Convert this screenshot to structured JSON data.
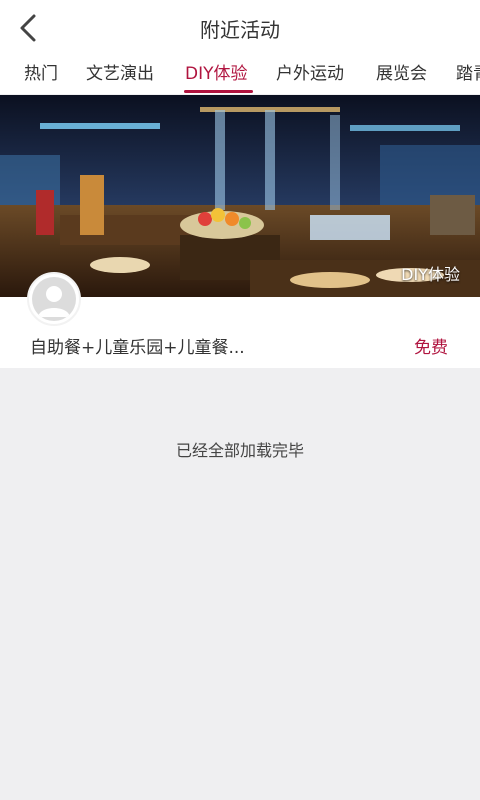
{
  "header": {
    "title": "附近活动",
    "back_icon": "chevron-left-icon"
  },
  "tabs": [
    {
      "label": "热门",
      "active": false
    },
    {
      "label": "文艺演出",
      "active": false
    },
    {
      "label": "DIY体验",
      "active": true
    },
    {
      "label": "户外运动",
      "active": false
    },
    {
      "label": "展览会",
      "active": false
    },
    {
      "label": "踏青",
      "active": false
    }
  ],
  "colors": {
    "accent": "#b0143f",
    "background": "#efeff1"
  },
  "activity": {
    "banner_tag": "DIY体验",
    "title": "自助餐+儿童乐园+儿童餐...",
    "price": "免费",
    "avatar_icon": "user-avatar-icon"
  },
  "list_status": "已经全部加载完毕"
}
